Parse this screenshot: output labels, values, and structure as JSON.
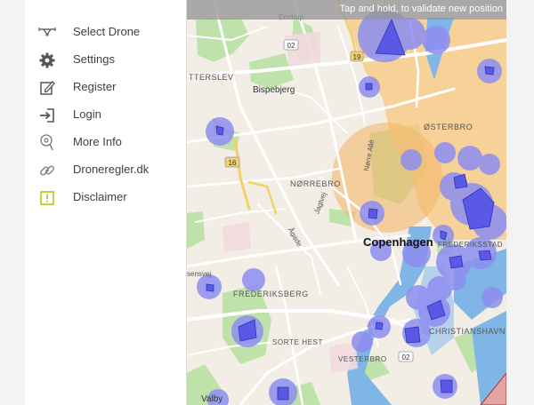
{
  "menu": {
    "items": [
      {
        "label": "Select Drone",
        "icon": "drone-icon"
      },
      {
        "label": "Settings",
        "icon": "gear-icon"
      },
      {
        "label": "Register",
        "icon": "edit-icon"
      },
      {
        "label": "Login",
        "icon": "login-icon"
      },
      {
        "label": "More Info",
        "icon": "info-icon"
      },
      {
        "label": "Droneregler.dk",
        "icon": "link-icon"
      },
      {
        "label": "Disclaimer",
        "icon": "warning-icon"
      }
    ]
  },
  "map": {
    "banner": "Tap and hold, to validate new position",
    "labels": {
      "emdrup": "Emdrup",
      "ttersslev": "TTERSLEV",
      "bispebjerg": "Bispebjerg",
      "osterbro": "ØSTERBRO",
      "norrebro": "NØRREBRO",
      "copenhagen": "Copenhagen",
      "frederiksberg": "FREDERIKSBERG",
      "sorte_hest": "SORTE HEST",
      "christianshavn": "CHRISTIANSHAVN",
      "vesterbro": "VESTERBRO",
      "valby": "Valby",
      "frederiksstad": "FREDERIKSSTAD",
      "norre_alle": "Nørre Allé",
      "jagtvej": "Jagtvej",
      "agade": "Ågade",
      "sensvej": "sensvej"
    },
    "road_badges": {
      "r02_top": "02",
      "r19": "19",
      "r16": "16",
      "r02_bottom": "02"
    },
    "colors": {
      "restricted_zone": "#5f5ee8",
      "buffer_zone": "#8f8fea",
      "airport_zone": "#f7c77e",
      "park": "#b9dfa6",
      "water": "#7fb3e4"
    }
  }
}
